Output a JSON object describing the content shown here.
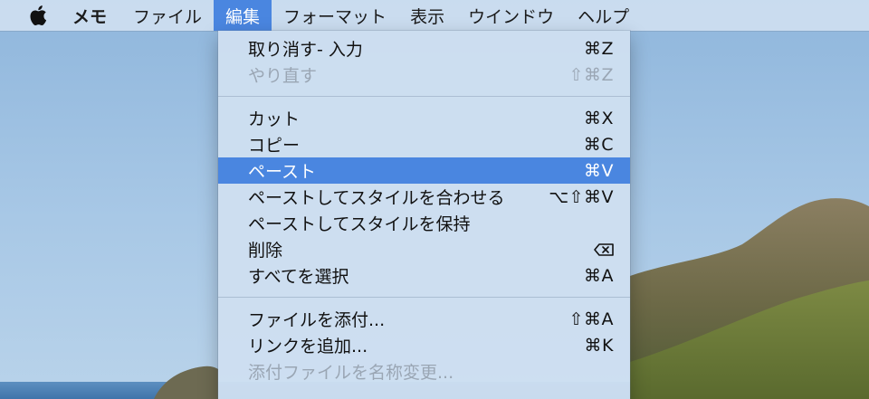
{
  "menubar": {
    "apple_icon": "apple-logo-icon",
    "app_name": "メモ",
    "items": [
      "ファイル",
      "編集",
      "フォーマット",
      "表示",
      "ウインドウ",
      "ヘルプ"
    ],
    "active_item": "編集"
  },
  "edit_menu": {
    "items": [
      {
        "label": "取り消す- 入力",
        "shortcut": "⌘Z"
      },
      {
        "label": "やり直す",
        "shortcut": "⇧⌘Z"
      },
      {
        "label": "カット",
        "shortcut": "⌘X"
      },
      {
        "label": "コピー",
        "shortcut": "⌘C"
      },
      {
        "label": "ペースト",
        "shortcut": "⌘V"
      },
      {
        "label": "ペーストしてスタイルを合わせる",
        "shortcut": "⌥⇧⌘V"
      },
      {
        "label": "ペーストしてスタイルを保持",
        "shortcut": ""
      },
      {
        "label": "削除",
        "shortcut": "delete-key-icon"
      },
      {
        "label": "すべてを選択",
        "shortcut": "⌘A"
      },
      {
        "label": "ファイルを添付...",
        "shortcut": "⇧⌘A"
      },
      {
        "label": "リンクを追加...",
        "shortcut": "⌘K"
      },
      {
        "label": "添付ファイルを名称変更...",
        "shortcut": ""
      }
    ],
    "highlighted": "ペースト",
    "disabled": [
      "やり直す",
      "添付ファイルを名称変更..."
    ]
  },
  "colors": {
    "accent": "#4a86e0",
    "menu_bg": "#cedff0",
    "disabled_text": "#9aa6b4"
  }
}
